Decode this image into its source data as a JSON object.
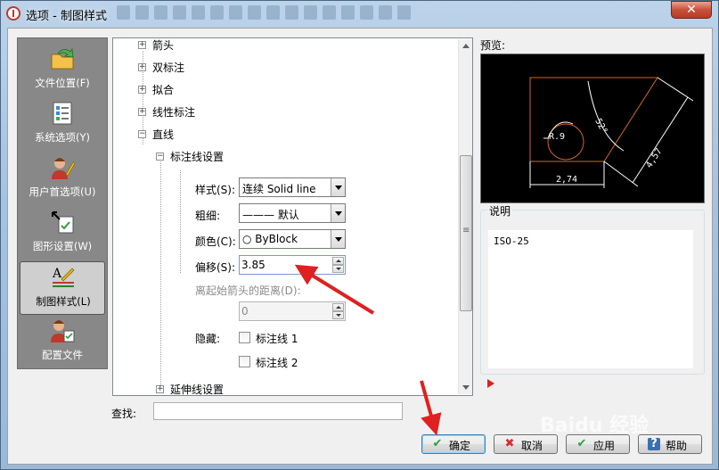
{
  "window": {
    "title": "选项 - 制图样式",
    "close_glyph": "✕"
  },
  "nav": {
    "items": [
      {
        "label": "文件位置(F)",
        "icon": "folder-arrow-icon"
      },
      {
        "label": "系统选项(Y)",
        "icon": "checklist-icon"
      },
      {
        "label": "用户首选项(U)",
        "icon": "user-pencil-icon"
      },
      {
        "label": "图形设置(W)",
        "icon": "graphics-settings-icon"
      },
      {
        "label": "制图样式(L)",
        "icon": "drafting-style-icon",
        "active": true
      },
      {
        "label": "配置文件",
        "icon": "user-profile-icon"
      }
    ]
  },
  "tree": {
    "nodes": [
      "箭头",
      "双标注",
      "拟合",
      "线性标注",
      "直线",
      "标注线设置",
      "延伸线设置"
    ],
    "settings": {
      "style_label": "样式(S):",
      "style_value": "连续      Solid line",
      "weight_label": "粗细:",
      "weight_value": "——— 默认",
      "color_label": "颜色(C):",
      "color_value": "○ ByBlock",
      "offset_label": "偏移(S):",
      "offset_value": "3.85",
      "distance_label": "离起始箭头的距离(D):",
      "distance_value": "0",
      "hide_label": "隐藏:",
      "hide_line1": "标注线 1",
      "hide_line2": "标注线 2"
    }
  },
  "preview": {
    "label": "预览:",
    "dim_radius": "R.9",
    "dim_angle": "52°",
    "dim_width": "2,74",
    "dim_diagonal": "4,57"
  },
  "description": {
    "title": "说明",
    "text": "ISO-25"
  },
  "search": {
    "label": "查找:",
    "value": ""
  },
  "buttons": {
    "ok": {
      "label": "确定",
      "icon": "✔"
    },
    "cancel": {
      "label": "取消",
      "icon": "✖"
    },
    "apply": {
      "label": "应用",
      "icon": "✔"
    },
    "help": {
      "label": "帮助",
      "icon": "?"
    }
  },
  "watermark": "Baidu 经验",
  "colors": {
    "accent_red": "#e02020",
    "preview_line": "#d2691e"
  }
}
